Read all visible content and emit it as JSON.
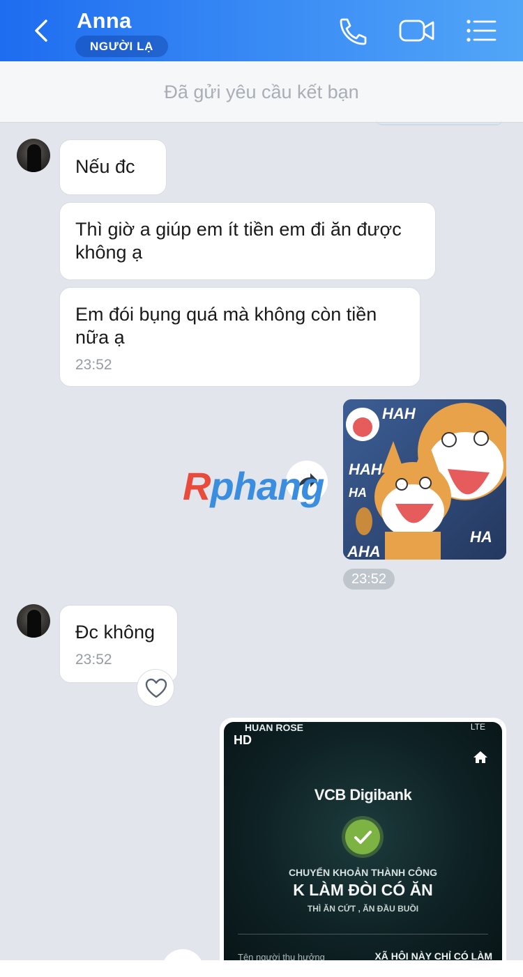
{
  "header": {
    "contact_name": "Anna",
    "badge": "NGƯỜI LẠ",
    "accent_color": "#1e6cf0"
  },
  "friend_request": {
    "text": "Đã gửi yêu cầu kết bạn"
  },
  "messages": [
    {
      "sender": "Anna",
      "text": "Nếu đc"
    },
    {
      "sender": "Anna",
      "text": "Thì giờ a giúp em ít tiền em đi ăn được không ạ"
    },
    {
      "sender": "Anna",
      "text": "Em đói bụng quá mà không còn tiền nữa ạ",
      "time": "23:52"
    },
    {
      "sender": "me",
      "type": "sticker",
      "time": "23:52"
    },
    {
      "sender": "Anna",
      "text": "Đc không",
      "time": "23:52"
    },
    {
      "sender": "me",
      "type": "image"
    }
  ],
  "sticker": {
    "hah_texts": [
      "HAH",
      "HAH",
      "HA",
      "HA",
      "AHA"
    ]
  },
  "watermark": {
    "r": "R",
    "rest": "phang"
  },
  "image_card": {
    "status_left": "HUAN ROSE",
    "status_right": "LTE",
    "hd": "HD",
    "brand": "VCB Digibank",
    "line1": "CHUYỂN KHOẢN THÀNH CÔNG",
    "line2": "K LÀM ĐÒI CÓ ĂN",
    "line3": "THÌ ĂN CỨT , ĂN ĐẦU BUỒI",
    "label": "Tên người thụ hưởng",
    "value": "XÃ HỘI NÀY CHỈ CÓ LÀM"
  },
  "icons": {
    "back": "chevron-left-icon",
    "call": "phone-icon",
    "video": "video-camera-icon",
    "menu": "list-menu-icon",
    "forward": "forward-arrow-icon",
    "react": "heart-icon"
  }
}
